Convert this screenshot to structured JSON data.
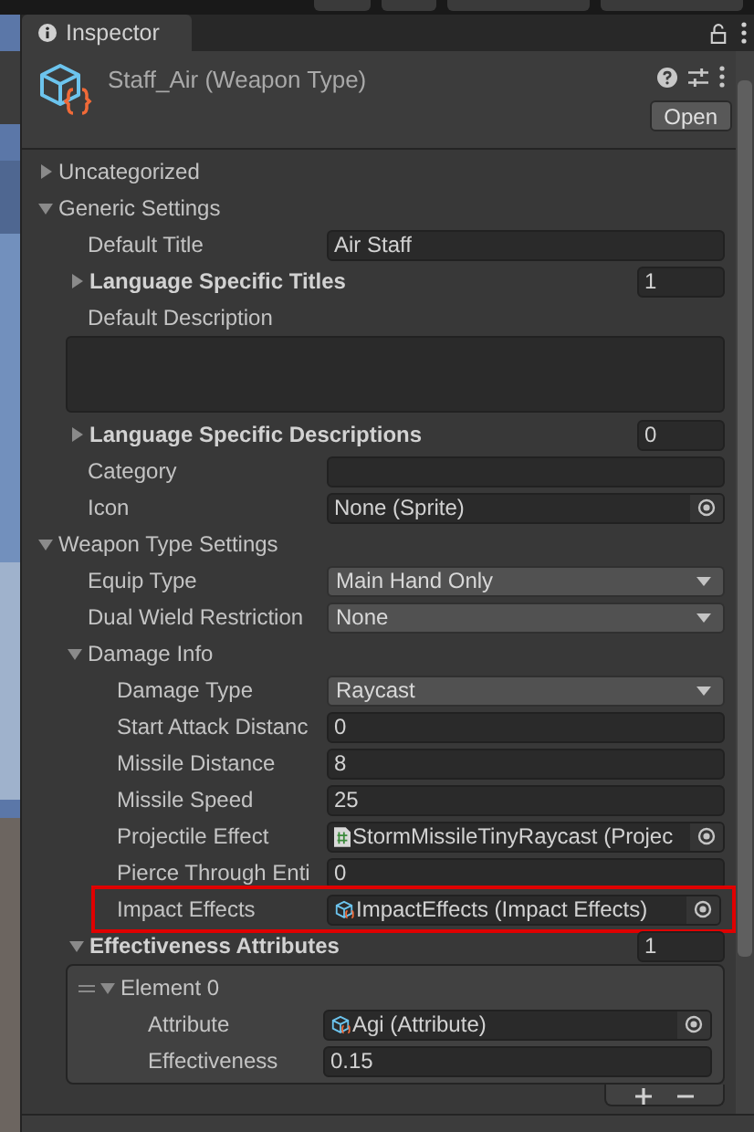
{
  "tab": {
    "label": "Inspector",
    "selected": true
  },
  "header": {
    "title": "Staff_Air (Weapon Type)",
    "open_button": "Open"
  },
  "properties": [
    {
      "kind": "foldout",
      "label": "Uncategorized",
      "expanded": false
    },
    {
      "kind": "foldout",
      "label": "Generic Settings",
      "expanded": true,
      "children": [
        {
          "kind": "text",
          "label": "Default Title",
          "value": "Air Staff"
        },
        {
          "kind": "array",
          "label": "Language Specific Titles",
          "count": "1",
          "expanded": false
        },
        {
          "kind": "textarea",
          "label": "Default Description"
        },
        {
          "kind": "array",
          "label": "Language Specific Descriptions",
          "count": "0",
          "expanded": false
        },
        {
          "kind": "text",
          "label": "Category"
        },
        {
          "kind": "object",
          "label": "Icon",
          "value": "None (Sprite)"
        }
      ]
    },
    {
      "kind": "foldout",
      "label": "Weapon Type Settings",
      "expanded": true,
      "children": [
        {
          "kind": "dropdown",
          "label": "Equip Type",
          "value": "Main Hand Only"
        },
        {
          "kind": "dropdown",
          "label": "Dual Wield Restriction",
          "value": "None"
        },
        {
          "kind": "foldout",
          "label": "Damage Info",
          "expanded": true,
          "children": [
            {
              "kind": "dropdown",
              "label": "Damage Type",
              "value": "Raycast"
            },
            {
              "kind": "text",
              "label": "Start Attack Distanc",
              "value": "0"
            },
            {
              "kind": "text",
              "label": "Missile Distance",
              "value": "8"
            },
            {
              "kind": "text",
              "label": "Missile Speed",
              "value": "25"
            },
            {
              "kind": "script_ref",
              "label": "Projectile Effect",
              "value": "StormMissileTinyRaycast (Projec"
            },
            {
              "kind": "text",
              "label": "Pierce Through Enti",
              "value": "0"
            },
            {
              "kind": "asset_ref",
              "label": "Impact Effects",
              "value": "ImpactEffects (Impact Effects)",
              "highlighted": true
            }
          ]
        },
        {
          "kind": "array",
          "label": "Effectiveness Attributes",
          "count": "1",
          "expanded": true,
          "children": [
            {
              "kind": "element",
              "label": "Element 0",
              "expanded": true,
              "children": [
                {
                  "kind": "asset_ref",
                  "label": "Attribute",
                  "value": "Agi (Attribute)"
                },
                {
                  "kind": "text",
                  "label": "Effectiveness",
                  "value": "0.15"
                }
              ]
            }
          ]
        }
      ]
    }
  ]
}
